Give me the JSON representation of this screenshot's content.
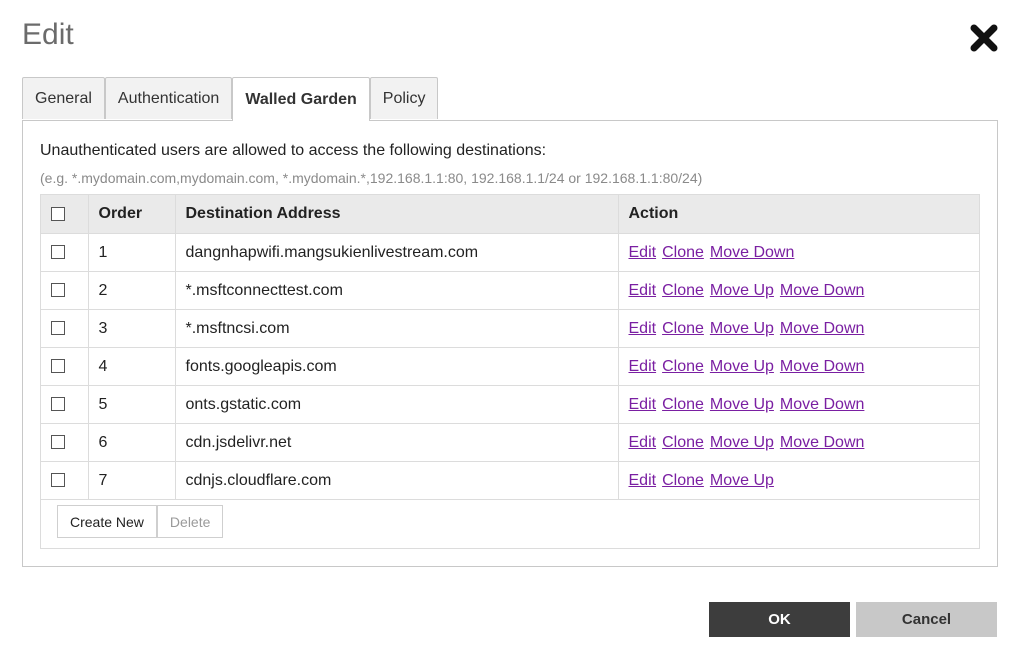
{
  "dialog": {
    "title": "Edit"
  },
  "tabs": [
    {
      "label": "General"
    },
    {
      "label": "Authentication"
    },
    {
      "label": "Walled Garden"
    },
    {
      "label": "Policy"
    }
  ],
  "walled_garden": {
    "intro": "Unauthenticated users are allowed to access the following destinations:",
    "example": "(e.g. *.mydomain.com,mydomain.com, *.mydomain.*,192.168.1.1:80, 192.168.1.1/24 or 192.168.1.1:80/24)",
    "columns": {
      "order": "Order",
      "destination": "Destination Address",
      "action": "Action"
    },
    "rows": [
      {
        "order": "1",
        "destination": "dangnhapwifi.mangsukienlivestream.com",
        "actions": [
          "Edit",
          "Clone",
          "Move Down"
        ]
      },
      {
        "order": "2",
        "destination": "*.msftconnecttest.com",
        "actions": [
          "Edit",
          "Clone",
          "Move Up",
          "Move Down"
        ]
      },
      {
        "order": "3",
        "destination": "*.msftncsi.com",
        "actions": [
          "Edit",
          "Clone",
          "Move Up",
          "Move Down"
        ]
      },
      {
        "order": "4",
        "destination": "fonts.googleapis.com",
        "actions": [
          "Edit",
          "Clone",
          "Move Up",
          "Move Down"
        ]
      },
      {
        "order": "5",
        "destination": "onts.gstatic.com",
        "actions": [
          "Edit",
          "Clone",
          "Move Up",
          "Move Down"
        ]
      },
      {
        "order": "6",
        "destination": "cdn.jsdelivr.net",
        "actions": [
          "Edit",
          "Clone",
          "Move Up",
          "Move Down"
        ]
      },
      {
        "order": "7",
        "destination": "cdnjs.cloudflare.com",
        "actions": [
          "Edit",
          "Clone",
          "Move Up"
        ]
      }
    ],
    "create_label": "Create New",
    "delete_label": "Delete"
  },
  "footer": {
    "ok_label": "OK",
    "cancel_label": "Cancel"
  },
  "colors": {
    "link": "#7a1fa2",
    "ok_bg": "#3d3d3d",
    "cancel_bg": "#c8c8c8"
  }
}
